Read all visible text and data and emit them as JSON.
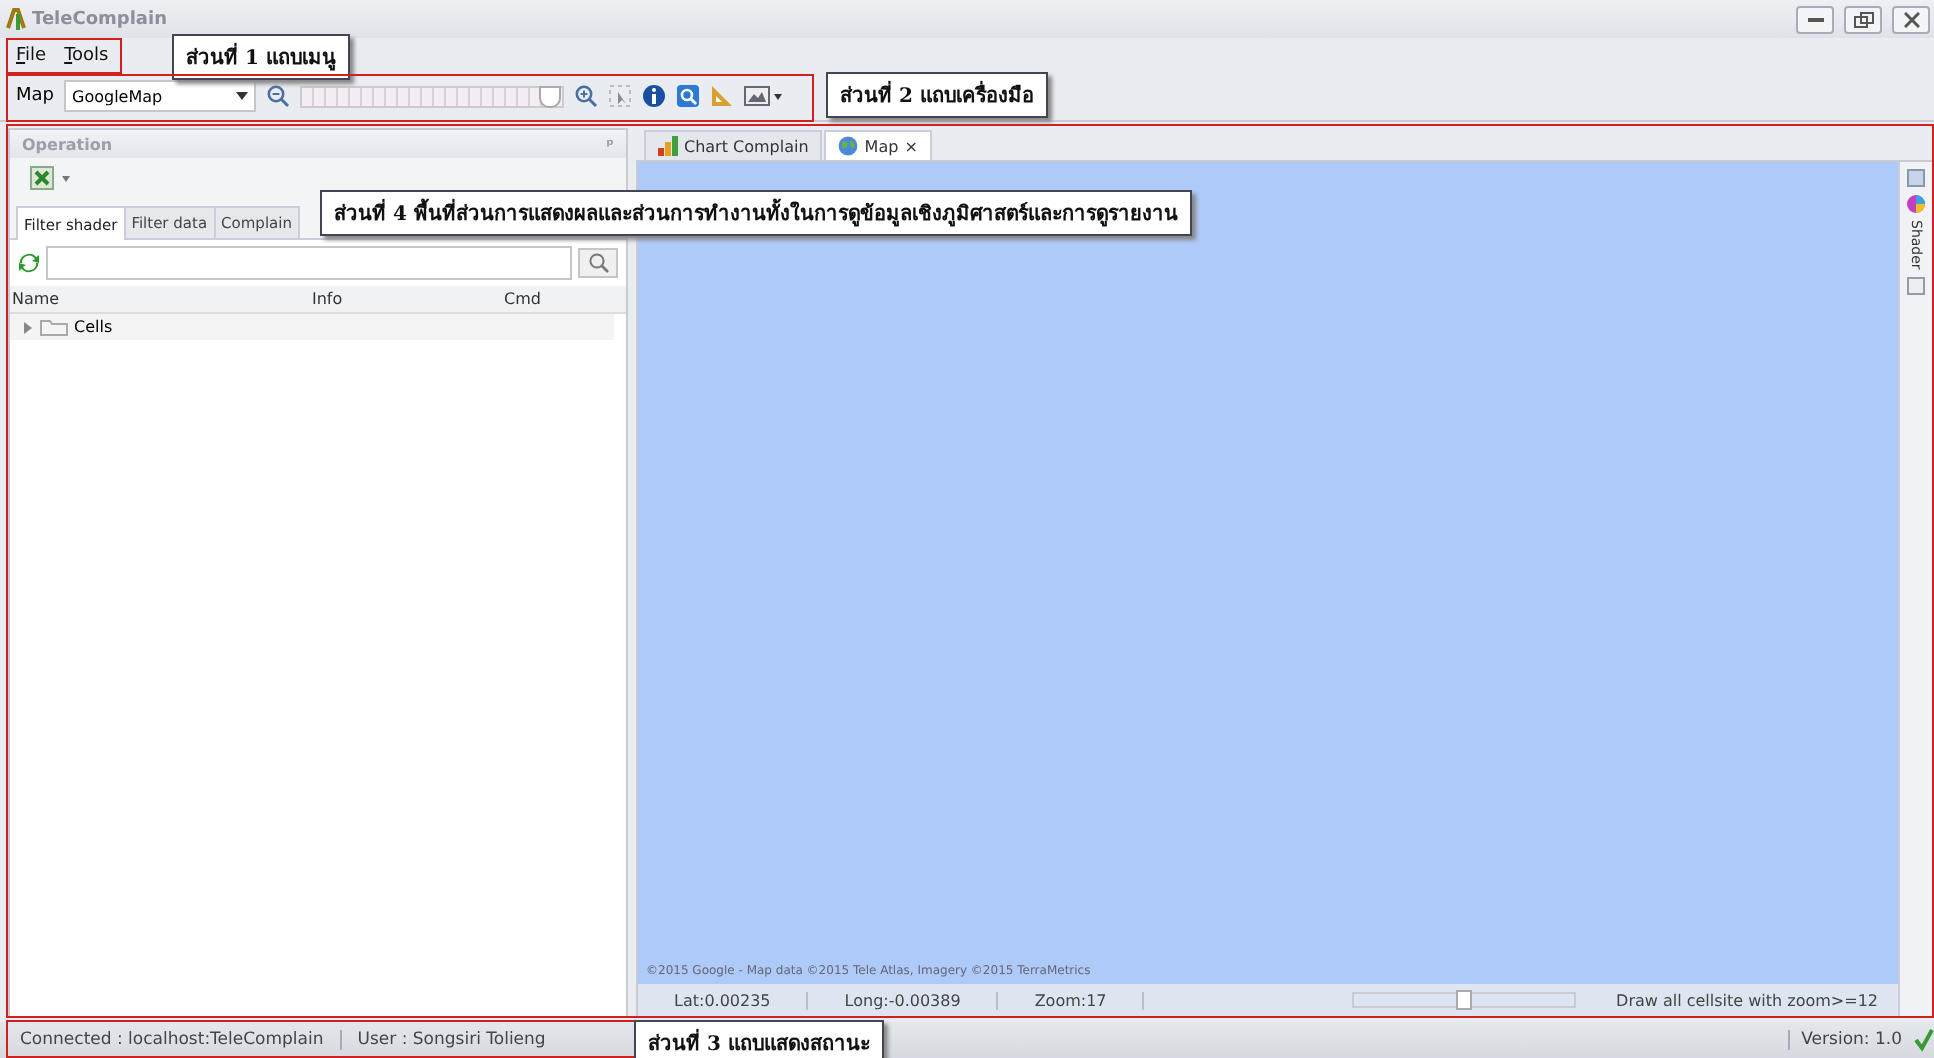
{
  "window": {
    "title": "TeleComplain"
  },
  "menu": [
    {
      "label": "File"
    },
    {
      "label": "Tools"
    }
  ],
  "toolbar": {
    "map_label": "Map",
    "map_select": "GoogleMap",
    "level": 0.95
  },
  "operation_panel": {
    "title": "Operation",
    "pin": "ᵖ",
    "tabs": [
      {
        "label": "Filter shader",
        "selected": true
      },
      {
        "label": "Filter data",
        "selected": false
      },
      {
        "label": "Complain",
        "selected": false
      }
    ],
    "columns": [
      "Name",
      "Info",
      "Cmd"
    ],
    "tree": [
      {
        "label": "Cells",
        "expanded": false
      }
    ]
  },
  "document_tabs": [
    {
      "label": "Chart Complain",
      "selected": false,
      "kind": "chart"
    },
    {
      "label": "Map",
      "selected": true,
      "kind": "map",
      "close": "×"
    }
  ],
  "map": {
    "attribution": "©2015 Google - Map data ©2015 Tele Atlas, Imagery ©2015 TerraMetrics",
    "lat": "Lat:0.00235",
    "long": "Long:-0.00389",
    "zoom": "Zoom:17",
    "level": 0.5,
    "draw_hint": "Draw all cellsite with zoom>=12",
    "side_tab": "Shader"
  },
  "status_bar": {
    "connection": "Connected : localhost:TeleComplain",
    "user": "User : Songsiri  Tolieng",
    "version": "Version: 1.0"
  },
  "annotations": [
    {
      "text": "ส่วนที่ 1 แถบเมนู"
    },
    {
      "text": "ส่วนที่ 2 แถบเครื่องมือ"
    },
    {
      "text": "ส่วนที่ 4  พื้นที่ส่วนการแสดงผลและส่วนการทำงานทั้งในการดูข้อมูลเชิงภูมิศาสตร์และการดูรายงาน"
    },
    {
      "text": "ส่วนที่ 3 แถบแสดงสถานะ"
    }
  ]
}
